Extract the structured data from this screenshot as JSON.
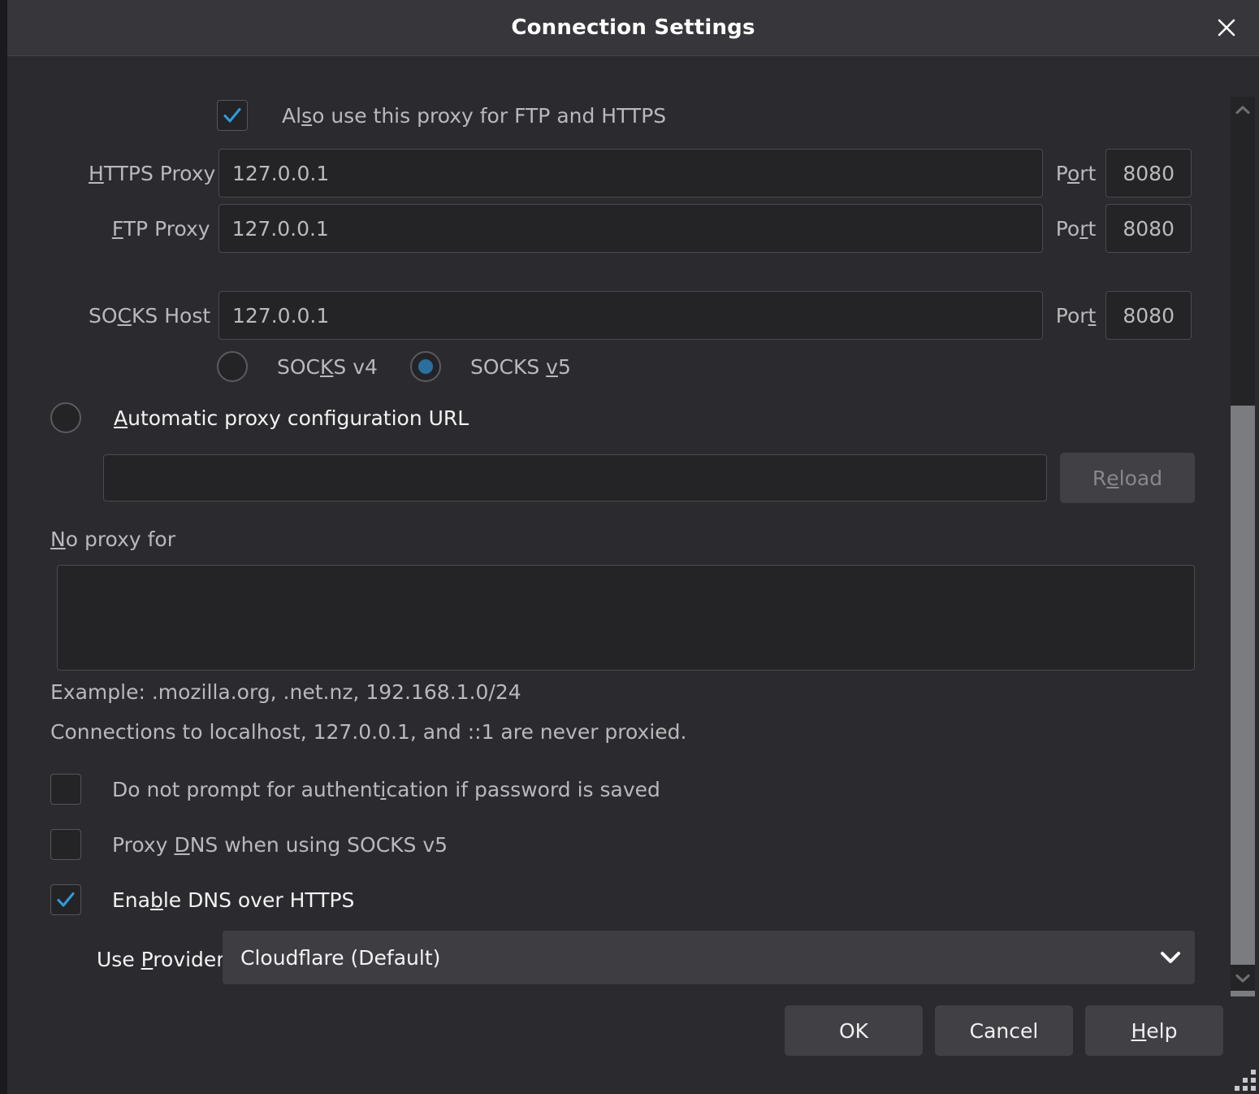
{
  "window": {
    "title": "Connection Settings",
    "close_icon": "close-icon"
  },
  "proxy": {
    "also_use_checkbox": {
      "label_pre": "Al",
      "label_accel": "s",
      "label_post": "o use this proxy for FTP and HTTPS",
      "checked": true
    },
    "https_proxy": {
      "label_accel": "H",
      "label_post": "TTPS Proxy",
      "value": "127.0.0.1",
      "port_label_pre": "P",
      "port_label_accel": "o",
      "port_label_post": "rt",
      "port_value": "8080"
    },
    "ftp_proxy": {
      "label_accel": "F",
      "label_post": "TP Proxy",
      "value": "127.0.0.1",
      "port_label_pre": "Po",
      "port_label_accel": "r",
      "port_label_post": "t",
      "port_value": "8080"
    },
    "socks_host": {
      "label_pre": "SO",
      "label_accel": "C",
      "label_post": "KS Host",
      "value": "127.0.0.1",
      "port_label_pre": "Por",
      "port_label_accel": "t",
      "port_label_post": "",
      "port_value": "8080"
    },
    "socks_version": {
      "v4": {
        "label_pre": "SOC",
        "label_accel": "K",
        "label_post": "S v4",
        "selected": false
      },
      "v5": {
        "label_pre": "SOCKS ",
        "label_accel": "v",
        "label_post": "5",
        "selected": true
      }
    },
    "auto_config": {
      "label_accel": "A",
      "label_post": "utomatic proxy configuration URL",
      "selected": false,
      "url_value": "",
      "reload_label_pre": "R",
      "reload_label_accel": "e",
      "reload_label_post": "load",
      "reload_enabled": false
    },
    "no_proxy_for": {
      "label_accel": "N",
      "label_post": "o proxy for",
      "value": "",
      "example_text": "Example: .mozilla.org, .net.nz, 192.168.1.0/24",
      "note_text": "Connections to localhost, 127.0.0.1, and ::1 are never proxied."
    },
    "no_prompt_auth": {
      "label_pre": "Do not prompt for authent",
      "label_accel": "i",
      "label_post": "cation if password is saved",
      "checked": false
    },
    "proxy_dns": {
      "label_pre": "Proxy ",
      "label_accel": "D",
      "label_post": "NS when using SOCKS v5",
      "checked": false
    },
    "enable_doh": {
      "label_pre": "Ena",
      "label_accel": "b",
      "label_post": "le DNS over HTTPS",
      "checked": true
    },
    "use_provider": {
      "label_pre": "Use ",
      "label_accel": "P",
      "label_post": "rovider",
      "selected_value": "Cloudflare (Default)",
      "dropdown_icon": "chevron-down-icon"
    }
  },
  "footer": {
    "ok_label": "OK",
    "cancel_label": "Cancel",
    "help_label_accel": "H",
    "help_label_post": "elp"
  },
  "scrollbar": {
    "up_icon": "chevron-up-icon",
    "down_icon": "chevron-down-icon"
  },
  "colors": {
    "accent_blue": "#2a6f9e",
    "check_blue": "#2f9de0",
    "dialog_bg": "#2b2b2f",
    "titlebar_bg": "#37373b",
    "input_bg": "#242427"
  }
}
